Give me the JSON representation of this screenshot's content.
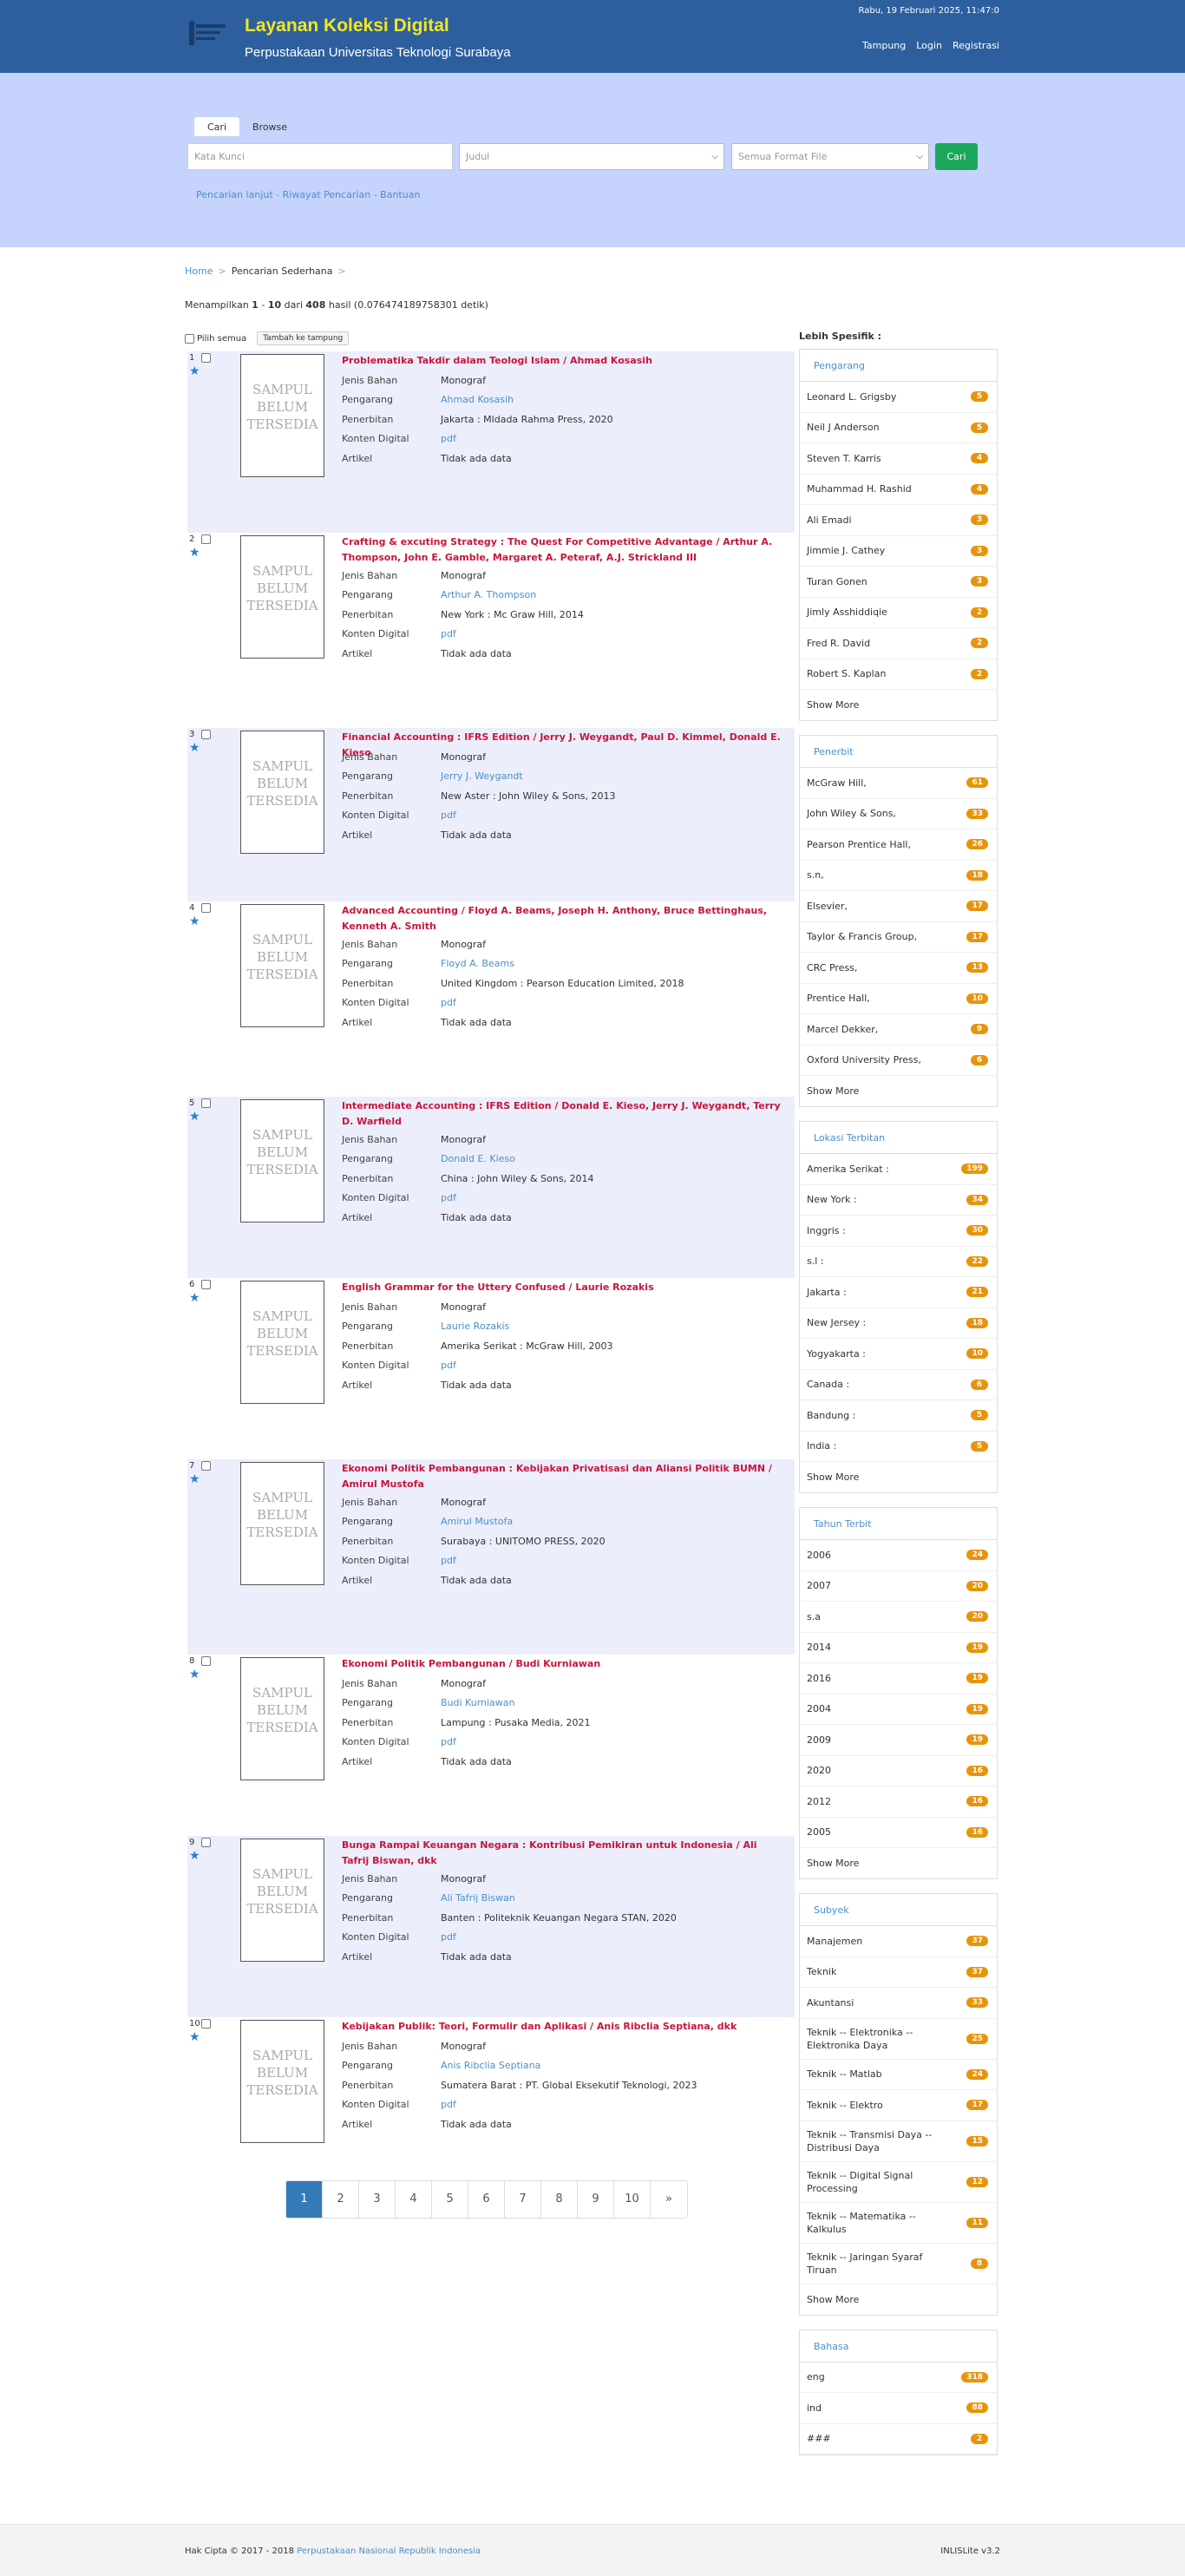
{
  "header": {
    "title": "Layanan Koleksi Digital",
    "subtitle": "Perpustakaan Universitas Teknologi Surabaya",
    "datetime": "Rabu, 19 Februari 2025, 11:47:0",
    "nav": [
      "Tampung",
      "Login",
      "Registrasi"
    ]
  },
  "search": {
    "tabs": [
      "Cari",
      "Browse"
    ],
    "keyword_placeholder": "Kata Kunci",
    "field_select": "Judul",
    "format_select": "Semua Format File",
    "button": "Cari",
    "links": [
      "Pencarian lanjut",
      "Riwayat Pencarian",
      "Bantuan"
    ]
  },
  "breadcrumb": [
    "Home",
    "Pencarian Sederhana"
  ],
  "result_info": {
    "prefix": "Menampilkan",
    "from": "1",
    "to": "10",
    "total": "408",
    "suffix": "hasil (0.076474189758301 detik)"
  },
  "select_all_label": "Pilih semua",
  "add_to_shelf": "Tambah ke tampung",
  "meta_labels": [
    "Jenis Bahan",
    "Pengarang",
    "Penerbitan",
    "Konten Digital",
    "Artikel"
  ],
  "cover_text": [
    "SAMPUL",
    "BELUM",
    "TERSEDIA"
  ],
  "results": [
    {
      "num": "1",
      "title": "Problematika Takdir dalam Teologi Islam / Ahmad Kosasih",
      "jenis": "Monograf",
      "pengarang": "Ahmad Kosasih",
      "penerbitan": "Jakarta : Mldada Rahma Press, 2020",
      "konten": "pdf",
      "artikel": "Tidak ada data"
    },
    {
      "num": "2",
      "title": "Crafting & excuting Strategy : The Quest For Competitive Advantage / Arthur A. Thompson, John E. Gamble, Margaret A. Peteraf, A.J. Strickland III",
      "jenis": "Monograf",
      "pengarang": "Arthur A. Thompson",
      "penerbitan": "New York : Mc Graw Hill, 2014",
      "konten": "pdf",
      "artikel": "Tidak ada data"
    },
    {
      "num": "3",
      "title": "Financial Accounting : IFRS Edition / Jerry J. Weygandt, Paul D. Kimmel, Donald E. Kieso",
      "jenis": "Monograf",
      "pengarang": "Jerry J. Weygandt",
      "penerbitan": "New Aster : John Wiley & Sons, 2013",
      "konten": "pdf",
      "artikel": "Tidak ada data"
    },
    {
      "num": "4",
      "title": "Advanced Accounting / Floyd A. Beams, Joseph H. Anthony, Bruce Bettinghaus, Kenneth A. Smith",
      "jenis": "Monograf",
      "pengarang": "Floyd A. Beams",
      "penerbitan": "United Kingdom : Pearson Education Limited, 2018",
      "konten": "pdf",
      "artikel": "Tidak ada data"
    },
    {
      "num": "5",
      "title": "Intermediate Accounting : IFRS Edition / Donald E. Kieso, Jerry J. Weygandt, Terry D. Warfield",
      "jenis": "Monograf",
      "pengarang": "Donald E. Kieso",
      "penerbitan": "China : John Wiley & Sons, 2014",
      "konten": "pdf",
      "artikel": "Tidak ada data"
    },
    {
      "num": "6",
      "title": "English Grammar for the Uttery Confused / Laurie Rozakis",
      "jenis": "Monograf",
      "pengarang": "Laurie Rozakis",
      "penerbitan": "Amerika Serikat : McGraw Hill, 2003",
      "konten": "pdf",
      "artikel": "Tidak ada data"
    },
    {
      "num": "7",
      "title": "Ekonomi Politik Pembangunan : Kebijakan Privatisasi dan Aliansi Politik BUMN / Amirul Mustofa",
      "jenis": "Monograf",
      "pengarang": "Amirul Mustofa",
      "penerbitan": "Surabaya : UNITOMO PRESS, 2020",
      "konten": "pdf",
      "artikel": "Tidak ada data"
    },
    {
      "num": "8",
      "title": "Ekonomi Politik Pembangunan / Budi Kurniawan",
      "jenis": "Monograf",
      "pengarang": "Budi Kurniawan",
      "penerbitan": "Lampung : Pusaka Media, 2021",
      "konten": "pdf",
      "artikel": "Tidak ada data"
    },
    {
      "num": "9",
      "title": "Bunga Rampai Keuangan Negara : Kontribusi Pemikiran untuk Indonesia / Ali Tafrij Biswan, dkk",
      "jenis": "Monograf",
      "pengarang": "Ali Tafrij Biswan",
      "penerbitan": "Banten : Politeknik Keuangan Negara STAN, 2020",
      "konten": "pdf",
      "artikel": "Tidak ada data"
    },
    {
      "num": "10",
      "title": "Kebijakan Publik: Teori, Formulir dan Aplikasi / Anis Ribclia Septiana, dkk",
      "jenis": "Monograf",
      "pengarang": "Anis Ribclia Septiana",
      "penerbitan": "Sumatera Barat : PT. Global Eksekutif Teknologi, 2023",
      "konten": "pdf",
      "artikel": "Tidak ada data"
    }
  ],
  "sidebar": {
    "title": "Lebih Spesifik :",
    "show_more": "Show More",
    "facets": [
      {
        "name": "Pengarang",
        "items": [
          [
            "Leonard L. Grigsby",
            "5"
          ],
          [
            "Neil J Anderson",
            "5"
          ],
          [
            "Steven T. Karris",
            "4"
          ],
          [
            "Muhammad H. Rashid",
            "4"
          ],
          [
            "Ali Emadi",
            "3"
          ],
          [
            "Jimmie J. Cathey",
            "3"
          ],
          [
            "Turan Gonen",
            "3"
          ],
          [
            "Jimly Asshiddiqie",
            "2"
          ],
          [
            "Fred R. David",
            "2"
          ],
          [
            "Robert S. Kaplan",
            "2"
          ]
        ]
      },
      {
        "name": "Penerbit",
        "items": [
          [
            "McGraw Hill,",
            "61"
          ],
          [
            "John Wiley & Sons,",
            "33"
          ],
          [
            "Pearson Prentice Hall,",
            "26"
          ],
          [
            "s.n,",
            "18"
          ],
          [
            "Elsevier,",
            "17"
          ],
          [
            "Taylor & Francis Group,",
            "17"
          ],
          [
            "CRC Press,",
            "13"
          ],
          [
            "Prentice Hall,",
            "10"
          ],
          [
            "Marcel Dekker,",
            "9"
          ],
          [
            "Oxford University Press,",
            "6"
          ]
        ]
      },
      {
        "name": "Lokasi Terbitan",
        "items": [
          [
            "Amerika Serikat :",
            "199"
          ],
          [
            "New York :",
            "34"
          ],
          [
            "Inggris :",
            "30"
          ],
          [
            "s.l :",
            "22"
          ],
          [
            "Jakarta :",
            "21"
          ],
          [
            "New Jersey :",
            "18"
          ],
          [
            "Yogyakarta :",
            "10"
          ],
          [
            "Canada :",
            "6"
          ],
          [
            "Bandung :",
            "5"
          ],
          [
            "India :",
            "5"
          ]
        ]
      },
      {
        "name": "Tahun Terbit",
        "items": [
          [
            "2006",
            "24"
          ],
          [
            "2007",
            "20"
          ],
          [
            "s.a",
            "20"
          ],
          [
            "2014",
            "19"
          ],
          [
            "2016",
            "19"
          ],
          [
            "2004",
            "19"
          ],
          [
            "2009",
            "19"
          ],
          [
            "2020",
            "16"
          ],
          [
            "2012",
            "16"
          ],
          [
            "2005",
            "16"
          ]
        ]
      },
      {
        "name": "Subyek",
        "items": [
          [
            "Manajemen",
            "37"
          ],
          [
            "Teknik",
            "37"
          ],
          [
            "Akuntansi",
            "33"
          ],
          [
            "Teknik -- Elektronika -- Elektronika Daya",
            "25"
          ],
          [
            "Teknik -- Matlab",
            "24"
          ],
          [
            "Teknik -- Elektro",
            "17"
          ],
          [
            "Teknik -- Transmisi Daya -- Distribusi Daya",
            "15"
          ],
          [
            "Teknik -- Digital Signal Processing",
            "12"
          ],
          [
            "Teknik -- Matematika -- Kalkulus",
            "11"
          ],
          [
            "Teknik -- Jaringan Syaraf Tiruan",
            "8"
          ]
        ]
      },
      {
        "name": "Bahasa",
        "items": [
          [
            "eng",
            "318"
          ],
          [
            "ind",
            "88"
          ],
          [
            "###",
            "2"
          ]
        ],
        "no_more": true
      }
    ]
  },
  "pagination": [
    "1",
    "2",
    "3",
    "4",
    "5",
    "6",
    "7",
    "8",
    "9",
    "10",
    "»"
  ],
  "footer": {
    "copy_prefix": "Hak Cipta © 2017 - 2018",
    "copy_link": "Perpustakaan Nasional Republik Indonesia",
    "version": "INLISLite v3.2"
  },
  "colors": {
    "header_bg": "#2d5f9e",
    "title_yellow": "#f3e620",
    "search_bg": "#c6d3fc",
    "result_title": "#c8163c",
    "badge": "#e8940a",
    "alt_row": "#eceefc"
  }
}
